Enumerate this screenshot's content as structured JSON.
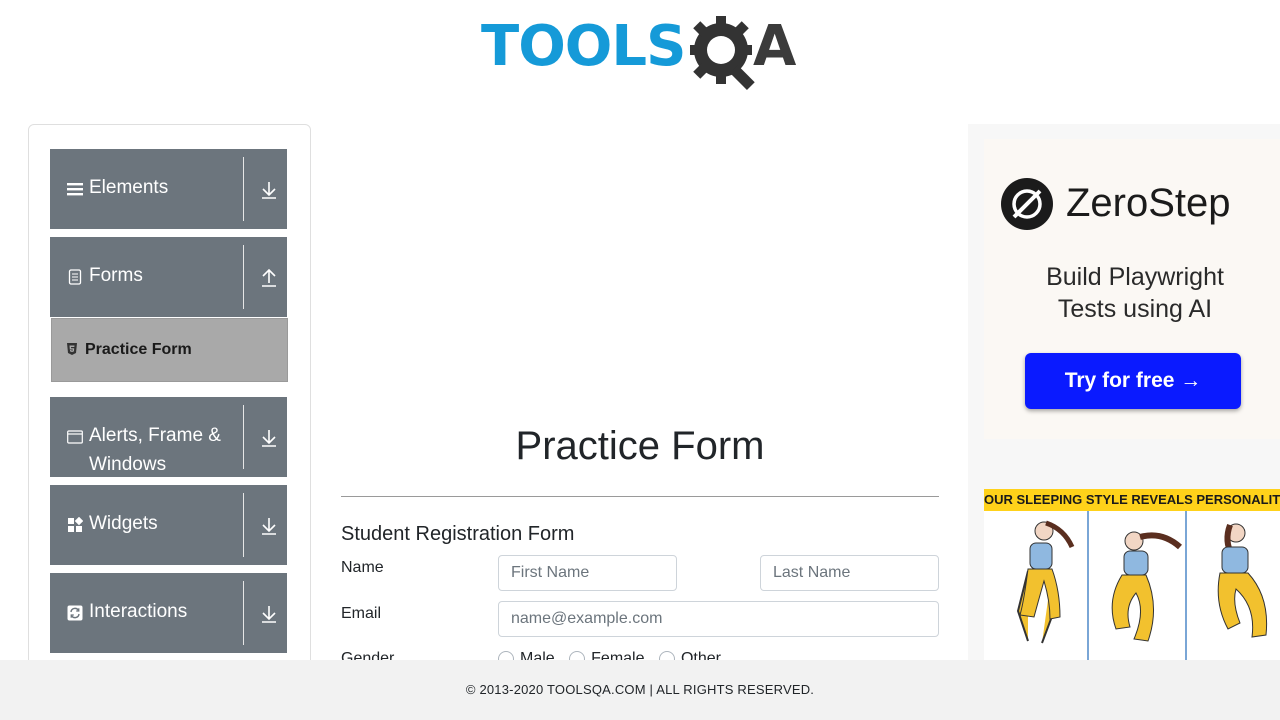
{
  "logo": {
    "part1": "TOOLS",
    "part2": "A"
  },
  "sidebar": {
    "groups": [
      {
        "label": "Elements",
        "icon": "list-icon",
        "arrow": "download-arrow-icon"
      },
      {
        "label": "Forms",
        "icon": "document-icon",
        "arrow": "upload-arrow-icon"
      },
      {
        "label": "Alerts, Frame &",
        "label2": "Windows",
        "icon": "window-icon",
        "arrow": "download-arrow-icon"
      },
      {
        "label": "Widgets",
        "icon": "widgets-icon",
        "arrow": "download-arrow-icon"
      },
      {
        "label": "Interactions",
        "icon": "refresh-icon",
        "arrow": "download-arrow-icon"
      }
    ],
    "active_item": {
      "label": "Practice Form",
      "icon": "html5-icon"
    }
  },
  "main": {
    "title": "Practice Form",
    "form_heading": "Student Registration Form",
    "name_label": "Name",
    "first_name_placeholder": "First Name",
    "last_name_placeholder": "Last Name",
    "email_label": "Email",
    "email_placeholder": "name@example.com",
    "gender_label": "Gender",
    "gender_options": [
      "Male",
      "Female",
      "Other"
    ]
  },
  "ad": {
    "brand": "ZeroStep",
    "tagline_line1": "Build Playwright",
    "tagline_line2": "Tests using AI",
    "cta": "Try for free →",
    "banner2": "OUR SLEEPING STYLE REVEALS PERSONALITY"
  },
  "footer": {
    "text": "© 2013-2020 TOOLSQA.COM | ALL RIGHTS RESERVED."
  },
  "colors": {
    "accent": "#159ad8",
    "sidebar_group": "#6c757d",
    "active_item": "#a9a9a9",
    "cta": "#0a1aff",
    "footer_bg": "#f2f2f2"
  }
}
